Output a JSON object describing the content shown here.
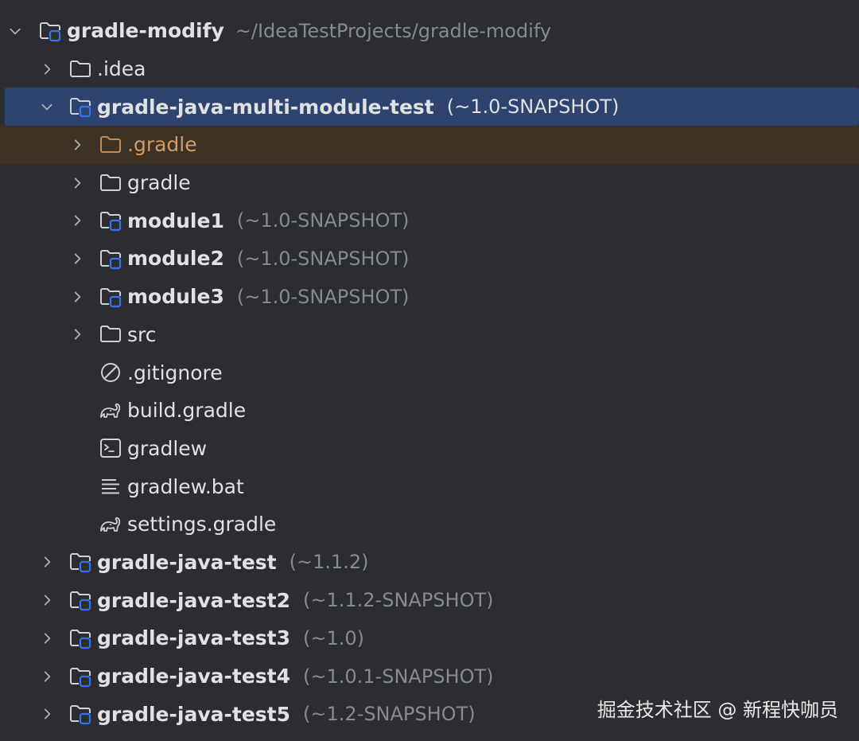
{
  "project_tree": {
    "rows": [
      {
        "label": "gradle-modify",
        "secondary": "~/IdeaTestProjects/gradle-modify",
        "icon": "module-folder-icon",
        "expanded": true,
        "depth": 0
      },
      {
        "label": ".idea",
        "icon": "folder-icon",
        "expanded": false,
        "depth": 1
      },
      {
        "label": "gradle-java-multi-module-test",
        "version": "(~1.0-SNAPSHOT)",
        "icon": "module-folder-icon",
        "expanded": true,
        "selected": true,
        "depth": 1
      },
      {
        "label": ".gradle",
        "icon": "folder-icon",
        "expanded": false,
        "excluded": true,
        "depth": 2
      },
      {
        "label": "gradle",
        "icon": "folder-icon",
        "expanded": false,
        "depth": 2
      },
      {
        "label": "module1",
        "version": "(~1.0-SNAPSHOT)",
        "icon": "module-folder-icon",
        "expanded": false,
        "depth": 2
      },
      {
        "label": "module2",
        "version": "(~1.0-SNAPSHOT)",
        "icon": "module-folder-icon",
        "expanded": false,
        "depth": 2
      },
      {
        "label": "module3",
        "version": "(~1.0-SNAPSHOT)",
        "icon": "module-folder-icon",
        "expanded": false,
        "depth": 2
      },
      {
        "label": "src",
        "icon": "folder-icon",
        "expanded": false,
        "depth": 2
      },
      {
        "label": ".gitignore",
        "icon": "ignore-file-icon",
        "depth": 2
      },
      {
        "label": "build.gradle",
        "icon": "gradle-elephant-icon",
        "depth": 2
      },
      {
        "label": "gradlew",
        "icon": "terminal-script-icon",
        "depth": 2
      },
      {
        "label": "gradlew.bat",
        "icon": "text-file-icon",
        "depth": 2
      },
      {
        "label": "settings.gradle",
        "icon": "gradle-elephant-icon",
        "depth": 2
      },
      {
        "label": "gradle-java-test",
        "version": "(~1.1.2)",
        "icon": "module-folder-icon",
        "expanded": false,
        "depth": 1
      },
      {
        "label": "gradle-java-test2",
        "version": "(~1.1.2-SNAPSHOT)",
        "icon": "module-folder-icon",
        "expanded": false,
        "depth": 1
      },
      {
        "label": "gradle-java-test3",
        "version": "(~1.0)",
        "icon": "module-folder-icon",
        "expanded": false,
        "depth": 1
      },
      {
        "label": "gradle-java-test4",
        "version": "(~1.0.1-SNAPSHOT)",
        "icon": "module-folder-icon",
        "expanded": false,
        "depth": 1
      },
      {
        "label": "gradle-java-test5",
        "version": "(~1.2-SNAPSHOT)",
        "icon": "module-folder-icon",
        "expanded": false,
        "depth": 1
      }
    ]
  },
  "watermark": "掘金技术社区 @ 新程快咖员",
  "colors": {
    "background": "#2b2d30",
    "selected_row": "#2e436e",
    "excluded_row": "#3d3223",
    "excluded_text": "#d19a66",
    "module_badge": "#3574f0",
    "secondary_text": "#868a91"
  }
}
